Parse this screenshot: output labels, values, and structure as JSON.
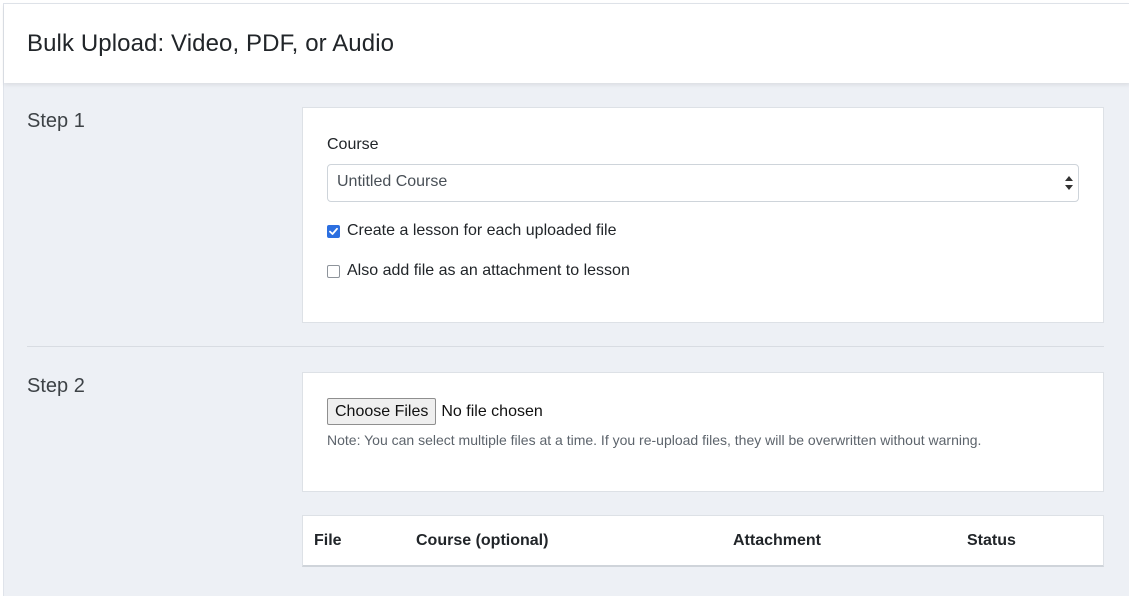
{
  "header": {
    "title": "Bulk Upload: Video, PDF, or Audio"
  },
  "step1": {
    "label": "Step 1",
    "course_label": "Course",
    "course_selected": "Untitled Course",
    "options": [
      {
        "label": "Create a lesson for each uploaded file",
        "checked": true
      },
      {
        "label": "Also add file as an attachment to lesson",
        "checked": false
      }
    ]
  },
  "step2": {
    "label": "Step 2",
    "choose_button": "Choose Files",
    "file_status": "No file chosen",
    "note": "Note: You can select multiple files at a time. If you re-upload files, they will be overwritten without warning."
  },
  "table": {
    "columns": [
      "File",
      "Course (optional)",
      "Attachment",
      "Status"
    ]
  },
  "colors": {
    "accent": "#2c6fe0",
    "background": "#edf0f5"
  },
  "icons": {
    "select": "sort-arrows-icon",
    "check": "check-icon"
  }
}
